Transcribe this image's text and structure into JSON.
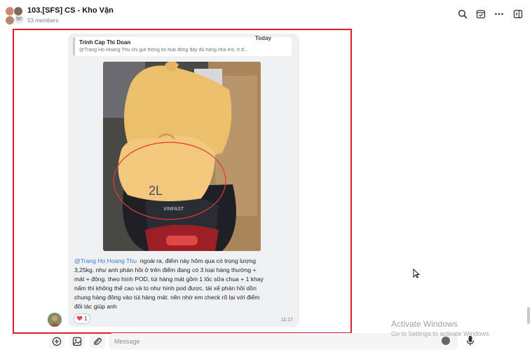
{
  "header": {
    "title": "103.[SFS] CS - Kho Vận",
    "members": "53 members",
    "avatar_count": "50"
  },
  "message": {
    "date_label": "Today",
    "quote": {
      "author": "Trinh Cap Thi Doan",
      "text": "@Trang Ho Hoang Thu chị gửi thông tin hub đồng đầy đủ hàng nha em, tt đ..."
    },
    "mention": "@Trang Ho Hoang Thu",
    "body": "ngoài ra, điểm này hôm qua có trọng lượng 3,25kg. như anh phản hồi ở trên điểm đang có 3 loại hàng thường + mát + đông. theo hình POD, túi hàng mát gồm 1 lốc sữa chua + 1 khay nấm thì không thể cao và to như hình pod được. tài xế phản hồi dồn chung hàng đông vào túi hàng mát. nên nhờ em check rõ lại với điểm đối tác giúp anh",
    "time": "11:17",
    "reaction": {
      "icon": "heart",
      "count": "1"
    },
    "photo_text": {
      "brand": "VINFAST",
      "marking": "2L"
    }
  },
  "composer": {
    "placeholder": "Message"
  },
  "overlay": {
    "activate_title": "Activate Windows",
    "activate_sub": "Go to Settings to activate Windows."
  },
  "colors": {
    "highlight_box": "#e0202a",
    "mention": "#3a7bd5",
    "bubble": "#eff0f2"
  }
}
